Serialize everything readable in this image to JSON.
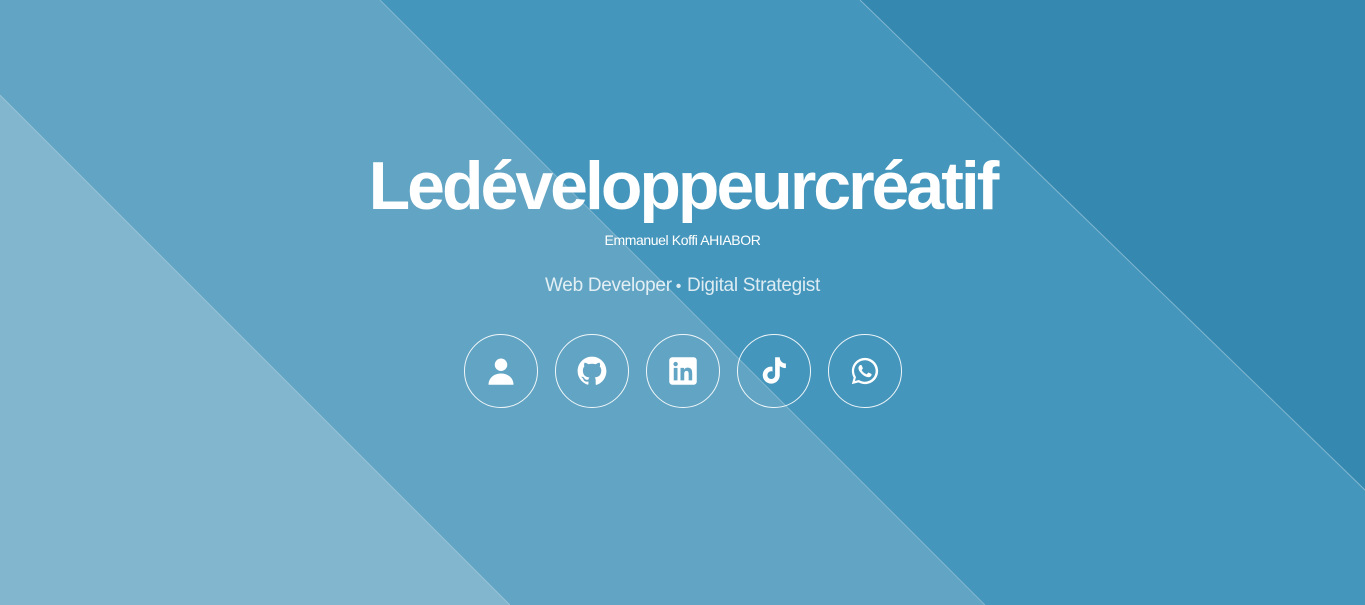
{
  "hero": {
    "title": "Ledéveloppeurcréatif",
    "subtitle": "Emmanuel Koffi AHIABOR",
    "roles": [
      "Web Developer",
      "Digital Strategist"
    ],
    "separator": "•"
  },
  "socials": [
    {
      "name": "profile",
      "icon": "user-icon"
    },
    {
      "name": "github",
      "icon": "github-icon"
    },
    {
      "name": "linkedin",
      "icon": "linkedin-icon"
    },
    {
      "name": "tiktok",
      "icon": "tiktok-icon"
    },
    {
      "name": "whatsapp",
      "icon": "whatsapp-icon"
    }
  ],
  "colors": {
    "background_dark": "#3589b1",
    "background_mid": "#4596bc",
    "background_light": "#62a4c3",
    "background_lightest": "#82b6ce",
    "text": "#ffffff"
  }
}
